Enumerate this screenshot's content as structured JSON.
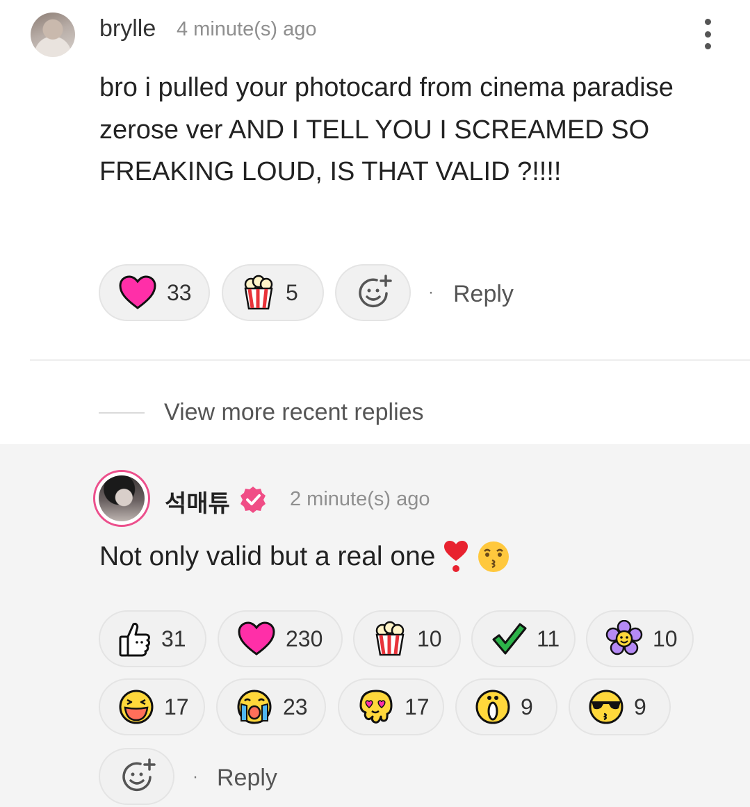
{
  "comment": {
    "username": "brylle",
    "timestamp": "4 minute(s) ago",
    "body": "bro i pulled your photocard from cinema paradise zerose ver AND I TELL YOU I SCREAMED SO FREAKING LOUD, IS THAT VALID ?!!!!",
    "reactions": [
      {
        "icon": "heart-icon",
        "count": "33"
      },
      {
        "icon": "popcorn-icon",
        "count": "5"
      }
    ],
    "reply_label": "Reply"
  },
  "view_more_label": "View more recent replies",
  "reply_comment": {
    "username": "석매튜",
    "verified": true,
    "timestamp": "2 minute(s) ago",
    "body": "Not only valid but a real one",
    "body_emojis": [
      "heart-exclamation-icon",
      "kissing-face-icon"
    ],
    "reactions": [
      {
        "icon": "thumbs-up-icon",
        "count": "31"
      },
      {
        "icon": "heart-icon",
        "count": "230"
      },
      {
        "icon": "popcorn-icon",
        "count": "10"
      },
      {
        "icon": "check-mark-icon",
        "count": "11"
      },
      {
        "icon": "flower-icon",
        "count": "10"
      },
      {
        "icon": "laughing-face-icon",
        "count": "17"
      },
      {
        "icon": "crying-face-icon",
        "count": "23"
      },
      {
        "icon": "heart-eyes-melting-icon",
        "count": "17"
      },
      {
        "icon": "shocked-face-icon",
        "count": "9"
      },
      {
        "icon": "sunglasses-face-icon",
        "count": "9"
      }
    ],
    "reply_label": "Reply"
  },
  "colors": {
    "heart": "#ff2fa8",
    "verified_badge": "#f04d86",
    "avatar_ring": "#ec4f8c",
    "emoji_yellow": "#ffd83b",
    "check_green": "#2db34a",
    "flower_purple": "#b58af5"
  }
}
